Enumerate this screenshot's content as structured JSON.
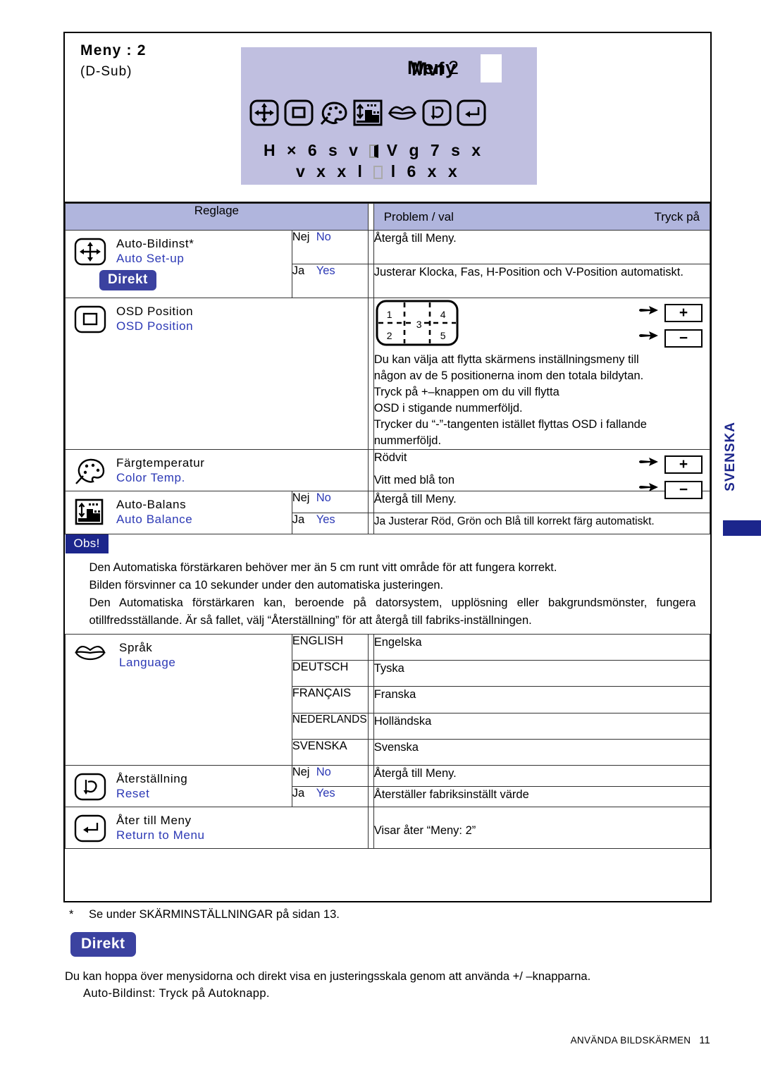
{
  "header": {
    "menu_title": "Meny : 2",
    "connector": "(D-Sub)"
  },
  "osd_preview": {
    "title_overlap_a": "Meny",
    "title_overlap_b": "Mvf",
    "title_number": "2",
    "icons": [
      "auto-setup-icon",
      "osd-position-icon",
      "color-temp-icon",
      "auto-balance-icon",
      "language-icon",
      "reset-icon",
      "return-to-menu-icon"
    ],
    "garbled_line_1": "H × 6 s v  V g 7 s x",
    "garbled_line_2": "v x x l   l 6 x x"
  },
  "table": {
    "columns": {
      "control": "Reglage",
      "problem": "Problem / val",
      "press": "Tryck på"
    },
    "rows": [
      {
        "id": "auto-setup",
        "icon": "auto-setup-icon",
        "label_sv": "Auto-Bildinst*",
        "label_en": "Auto Set-up",
        "badge": "Direkt",
        "options": [
          {
            "sv": "Nej",
            "en": "No",
            "desc": "Återgå till Meny."
          },
          {
            "sv": "Ja",
            "en": "Yes",
            "desc": "Justerar Klocka, Fas, H-Position och V-Position automatiskt."
          }
        ]
      },
      {
        "id": "osd-position",
        "icon": "osd-position-icon",
        "label_sv": "OSD Position",
        "label_en": "OSD Position",
        "diagram_numbers": [
          "1",
          "4",
          "3",
          "2",
          "5"
        ],
        "keys": [
          "+",
          "−"
        ],
        "desc_lines": [
          "Du kan välja att flytta skärmens inställningsmeny till",
          "någon av de 5 positionerna inom den totala bildytan.",
          "Tryck på +–knappen om du vill flytta",
          "OSD i stigande nummerföljd.",
          "Trycker du “-”-tangenten istället flyttas OSD i fallande",
          "nummerföljd."
        ]
      },
      {
        "id": "color-temp",
        "icon": "color-temp-icon",
        "label_sv": "Färgtemperatur",
        "label_en": "Color Temp.",
        "values": [
          "Rödvit",
          "Vitt med blå ton"
        ],
        "keys": [
          "+",
          "−"
        ]
      },
      {
        "id": "auto-balance",
        "icon": "auto-balance-icon",
        "label_sv": "Auto-Balans",
        "label_en": "Auto Balance",
        "options": [
          {
            "sv": "Nej",
            "en": "No",
            "desc": "Återgå till Meny."
          },
          {
            "sv": "Ja",
            "en": "Yes",
            "desc": "Ja Justerar Röd, Grön och Blå till korrekt färg automatiskt."
          }
        ]
      },
      {
        "id": "language",
        "icon": "language-icon",
        "label_sv": "Språk",
        "label_en": "Language",
        "languages": [
          {
            "option": "ENGLISH",
            "desc": "Engelska"
          },
          {
            "option": "DEUTSCH",
            "desc": "Tyska"
          },
          {
            "option": "FRANÇAIS",
            "desc": "Franska"
          },
          {
            "option": "NEDERLANDS",
            "desc": "Holländska"
          },
          {
            "option": "SVENSKA",
            "desc": "Svenska"
          }
        ]
      },
      {
        "id": "reset",
        "icon": "reset-icon",
        "label_sv": "Återställning",
        "label_en": "Reset",
        "options": [
          {
            "sv": "Nej",
            "en": "No",
            "desc": "Återgå till Meny."
          },
          {
            "sv": "Ja",
            "en": "Yes",
            "desc": "Återställer fabriksinställt värde"
          }
        ]
      },
      {
        "id": "return-to-menu",
        "icon": "return-to-menu-icon",
        "label_sv": "Åter till Meny",
        "label_en": "Return to Menu",
        "desc": "Visar åter “Meny: 2”"
      }
    ]
  },
  "note": {
    "badge": "Obs!",
    "lines": [
      "Den Automatiska förstärkaren behöver mer än 5 cm runt vitt område för att fungera korrekt.",
      "Bilden försvinner ca 10 sekunder under den automatiska justeringen.",
      "Den Automatiska förstärkaren kan, beroende på datorsystem, upplösning eller bakgrundsmönster, fungera otillfredsställande. Är så fallet, välj “Återställning” för att återgå till fabriks-inställningen."
    ]
  },
  "footnote": {
    "marker": "*",
    "text": "Se under SKÄRMINSTÄLLNINGAR på sidan 13."
  },
  "direct_section": {
    "badge": "Direkt",
    "paragraph": "Du kan hoppa över menysidorna och direkt visa en justeringsskala genom att använda +/ –knapparna.",
    "item": "Auto-Bildinst: Tryck på Autoknapp."
  },
  "side_tab": {
    "label": "SVENSKA"
  },
  "page_footer": {
    "section": "ANVÄNDA BILDSKÄRMEN",
    "page_number": "11"
  },
  "colors": {
    "accent_blue": "#3b42a0",
    "link_blue": "#2c39b5",
    "header_fill": "#b0b5dd",
    "osd_fill": "#c0bfe0",
    "note_badge": "#1c268c"
  }
}
